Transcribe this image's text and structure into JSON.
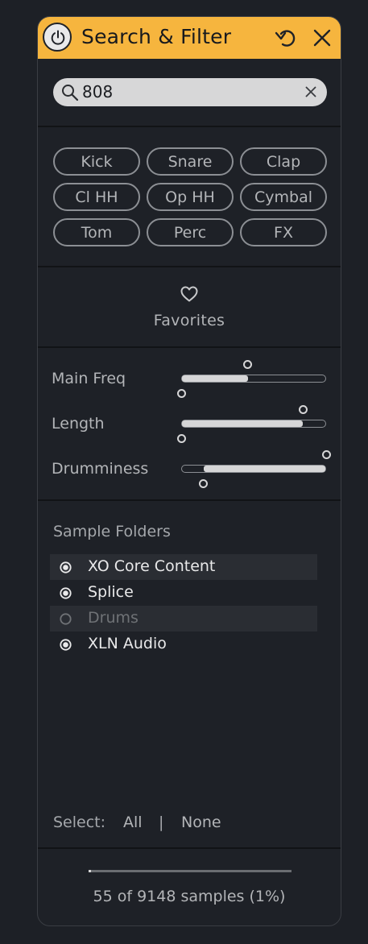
{
  "header": {
    "title": "Search & Filter",
    "accent": "#f6b53e"
  },
  "search": {
    "value": "808",
    "placeholder": ""
  },
  "tags": [
    "Kick",
    "Snare",
    "Clap",
    "Cl HH",
    "Op HH",
    "Cymbal",
    "Tom",
    "Perc",
    "FX"
  ],
  "favorites": {
    "label": "Favorites"
  },
  "sliders": [
    {
      "label": "Main Freq",
      "range_low": 0.0,
      "range_high": 0.46
    },
    {
      "label": "Length",
      "range_low": 0.0,
      "range_high": 0.84
    },
    {
      "label": "Drumminess",
      "range_low": 0.15,
      "range_high": 1.0
    }
  ],
  "folders": {
    "title": "Sample Folders",
    "items": [
      {
        "label": "XO Core Content",
        "checked": true,
        "highlighted": true
      },
      {
        "label": "Splice",
        "checked": true,
        "highlighted": false
      },
      {
        "label": "Drums",
        "checked": false,
        "highlighted": true
      },
      {
        "label": "XLN Audio",
        "checked": true,
        "highlighted": false
      }
    ]
  },
  "select": {
    "label": "Select:",
    "all": "All",
    "separator": "|",
    "none": "None"
  },
  "status": {
    "text": "55 of 9148 samples (1%)",
    "progress": 0.01
  }
}
